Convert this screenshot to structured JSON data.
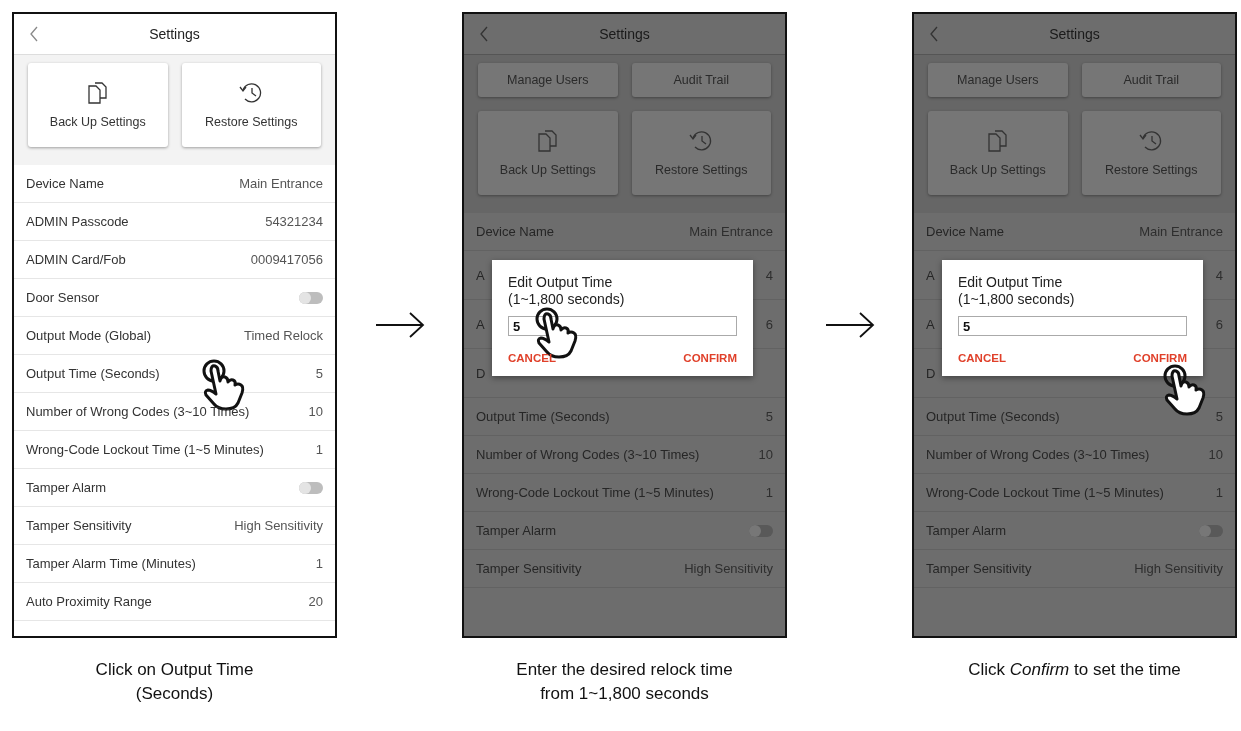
{
  "steps": [
    {
      "screen": {
        "title": "Settings",
        "tile_rows": [
          [
            {
              "label": "Back Up Settings",
              "kind": "backup"
            },
            {
              "label": "Restore Settings",
              "kind": "restore"
            }
          ]
        ],
        "rows": [
          {
            "label": "Device Name",
            "value": "Main Entrance",
            "kind": "text",
            "tapped": false
          },
          {
            "label": "ADMIN Passcode",
            "value": "54321234",
            "kind": "text",
            "tapped": false
          },
          {
            "label": "ADMIN Card/Fob",
            "value": "0009417056",
            "kind": "text",
            "tapped": false
          },
          {
            "label": "Door Sensor",
            "kind": "toggle",
            "on": false,
            "tapped": false
          },
          {
            "label": "Output Mode (Global)",
            "value": "Timed Relock",
            "kind": "text",
            "tapped": false
          },
          {
            "label": "Output Time (Seconds)",
            "value": "5",
            "kind": "text",
            "tapped": true
          },
          {
            "label": "Number of Wrong Codes (3~10 Times)",
            "value": "10",
            "kind": "text",
            "tapped": false
          },
          {
            "label": "Wrong-Code Lockout Time (1~5 Minutes)",
            "value": "1",
            "kind": "text",
            "tapped": false
          },
          {
            "label": "Tamper Alarm",
            "kind": "toggle",
            "on": false,
            "tapped": false
          },
          {
            "label": "Tamper Sensitivity",
            "value": "High Sensitivity",
            "kind": "text",
            "tapped": false
          },
          {
            "label": "Tamper Alarm Time (Minutes)",
            "value": "1",
            "kind": "text",
            "tapped": false
          },
          {
            "label": "Auto Proximity Range",
            "value": "20",
            "kind": "text",
            "tapped": false
          }
        ]
      },
      "caption": "Click on Output Time (Seconds)"
    },
    {
      "screen": {
        "title": "Settings",
        "tile_rows": [
          [
            {
              "label": "Manage Users",
              "kind": "plain"
            },
            {
              "label": "Audit Trail",
              "kind": "plain"
            }
          ],
          [
            {
              "label": "Back Up Settings",
              "kind": "backup"
            },
            {
              "label": "Restore Settings",
              "kind": "restore"
            }
          ]
        ],
        "rows": [
          {
            "label": "Device Name",
            "value": "Main Entrance",
            "kind": "text"
          },
          {
            "label": "A",
            "value": "4",
            "kind": "covered"
          },
          {
            "label": "A",
            "value": "6",
            "kind": "covered"
          },
          {
            "label": "D",
            "kind": "covered"
          },
          {
            "label": "Output Time (Seconds)",
            "value": "5",
            "kind": "text"
          },
          {
            "label": "Number of Wrong Codes (3~10 Times)",
            "value": "10",
            "kind": "text"
          },
          {
            "label": "Wrong-Code Lockout Time (1~5 Minutes)",
            "value": "1",
            "kind": "text"
          },
          {
            "label": "Tamper Alarm",
            "kind": "toggle",
            "on": false
          },
          {
            "label": "Tamper Sensitivity",
            "value": "High Sensitivity",
            "kind": "text"
          }
        ],
        "dialog": {
          "title": "Edit Output Time",
          "subtitle": "(1~1,800 seconds)",
          "value": "5",
          "input_tapped": true,
          "buttons": [
            {
              "label": "CANCEL",
              "tapped": false
            },
            {
              "label": "CONFIRM",
              "tapped": false
            }
          ]
        }
      },
      "caption": "Enter the desired relock time from 1~1,800 seconds"
    },
    {
      "screen": {
        "title": "Settings",
        "tile_rows": [
          [
            {
              "label": "Manage Users",
              "kind": "plain"
            },
            {
              "label": "Audit Trail",
              "kind": "plain"
            }
          ],
          [
            {
              "label": "Back Up Settings",
              "kind": "backup"
            },
            {
              "label": "Restore Settings",
              "kind": "restore"
            }
          ]
        ],
        "rows": [
          {
            "label": "Device Name",
            "value": "Main Entrance",
            "kind": "text"
          },
          {
            "label": "A",
            "value": "4",
            "kind": "covered"
          },
          {
            "label": "A",
            "value": "6",
            "kind": "covered"
          },
          {
            "label": "D",
            "kind": "covered"
          },
          {
            "label": "Output Time (Seconds)",
            "value": "5",
            "kind": "text"
          },
          {
            "label": "Number of Wrong Codes (3~10 Times)",
            "value": "10",
            "kind": "text"
          },
          {
            "label": "Wrong-Code Lockout Time (1~5 Minutes)",
            "value": "1",
            "kind": "text"
          },
          {
            "label": "Tamper Alarm",
            "kind": "toggle",
            "on": false
          },
          {
            "label": "Tamper Sensitivity",
            "value": "High Sensitivity",
            "kind": "text"
          }
        ],
        "dialog": {
          "title": "Edit Output Time",
          "subtitle": "(1~1,800 seconds)",
          "value": "5",
          "input_tapped": false,
          "buttons": [
            {
              "label": "CANCEL",
              "tapped": false
            },
            {
              "label": "CONFIRM",
              "tapped": true
            }
          ]
        }
      },
      "caption": "Click *Confirm* to set the time"
    }
  ]
}
